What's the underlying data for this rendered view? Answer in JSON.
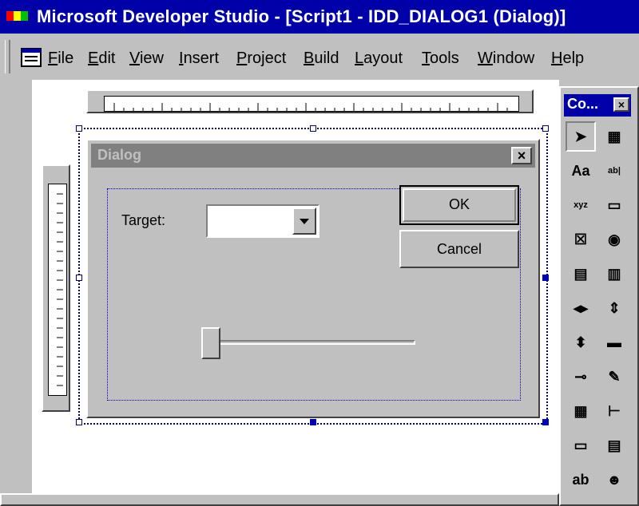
{
  "window": {
    "title": "Microsoft Developer Studio - [Script1 - IDD_DIALOG1 (Dialog)]"
  },
  "menu": [
    {
      "label": "File",
      "key": "F",
      "rest": "ile"
    },
    {
      "label": "Edit",
      "key": "E",
      "rest": "dit"
    },
    {
      "label": "View",
      "key": "V",
      "rest": "iew"
    },
    {
      "label": "Insert",
      "key": "I",
      "rest": "nsert"
    },
    {
      "label": "Project",
      "key": "P",
      "rest": "roject"
    },
    {
      "label": "Build",
      "key": "B",
      "rest": "uild"
    },
    {
      "label": "Layout",
      "key": "L",
      "rest": "ayout"
    },
    {
      "label": "Tools",
      "key": "T",
      "rest": "ools"
    },
    {
      "label": "Window",
      "key": "W",
      "rest": "indow"
    },
    {
      "label": "Help",
      "key": "H",
      "rest": "elp"
    }
  ],
  "dialog": {
    "title": "Dialog",
    "close_glyph": "×",
    "ok_label": "OK",
    "cancel_label": "Cancel",
    "target_label": "Target:",
    "combo_value": "",
    "slider_value": 0
  },
  "toolbox": {
    "title": "Co...",
    "close_glyph": "×",
    "tools": [
      {
        "name": "pointer-tool",
        "glyph": "➤"
      },
      {
        "name": "picture-tool",
        "glyph": "▦"
      },
      {
        "name": "static-text-tool",
        "glyph": "Aa"
      },
      {
        "name": "edit-box-tool",
        "glyph": "ab|"
      },
      {
        "name": "group-box-tool",
        "glyph": "xyz"
      },
      {
        "name": "button-tool",
        "glyph": "▭"
      },
      {
        "name": "check-box-tool",
        "glyph": "☒"
      },
      {
        "name": "radio-button-tool",
        "glyph": "◉"
      },
      {
        "name": "combo-box-tool",
        "glyph": "▤"
      },
      {
        "name": "list-box-tool",
        "glyph": "▥"
      },
      {
        "name": "horizontal-scrollbar-tool",
        "glyph": "◂▸"
      },
      {
        "name": "vertical-scrollbar-tool",
        "glyph": "⇕"
      },
      {
        "name": "spin-tool",
        "glyph": "⬍"
      },
      {
        "name": "progress-tool",
        "glyph": "▬"
      },
      {
        "name": "slider-tool",
        "glyph": "⊸"
      },
      {
        "name": "hotkey-tool",
        "glyph": "✎"
      },
      {
        "name": "list-control-tool",
        "glyph": "▦"
      },
      {
        "name": "tree-control-tool",
        "glyph": "⊢"
      },
      {
        "name": "tab-control-tool",
        "glyph": "▭"
      },
      {
        "name": "animate-tool",
        "glyph": "▤"
      },
      {
        "name": "rich-edit-tool",
        "glyph": "ab"
      },
      {
        "name": "custom-control-tool",
        "glyph": "☻"
      }
    ]
  },
  "colors": {
    "titlebar": "#0000a8",
    "face": "#c0c0c0",
    "selection": "#0000c0"
  }
}
